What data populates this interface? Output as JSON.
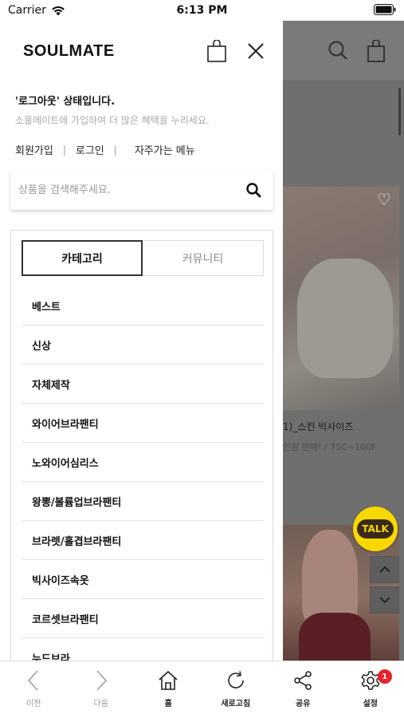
{
  "statusbar": {
    "carrier": "Carrier",
    "time": "6:13 PM"
  },
  "drawer": {
    "logo": "SOULMATE",
    "status_message": "'로그아웃' 상태입니다.",
    "status_sub": "소울메이트에 가입하여 더 많은 혜택을 누리세요.",
    "links": {
      "join": "회원가입",
      "login": "로그인",
      "favorites": "자주가는 메뉴"
    },
    "search": {
      "placeholder": "상품을 검색해주세요.",
      "value": ""
    },
    "tabs": {
      "category": "카테고리",
      "community": "커뮤니티"
    },
    "categories": [
      "베스트",
      "신상",
      "자체제작",
      "와이어브라팬티",
      "노와이어심리스",
      "왕뽕/볼륨업브라팬티",
      "브라렛/홀겹브라팬티",
      "빅사이즈속옷",
      "코르셋브라팬티",
      "누드브라"
    ]
  },
  "background": {
    "product_title": "1)_스킨 빅사이즈",
    "product_sub": "인원 판매! / 75C~100F",
    "talk_label": "TALK"
  },
  "bottombar": {
    "items": [
      {
        "label": "이전",
        "icon": "back-arrow-icon"
      },
      {
        "label": "다음",
        "icon": "forward-arrow-icon"
      },
      {
        "label": "홈",
        "icon": "home-icon"
      },
      {
        "label": "새로고침",
        "icon": "refresh-icon"
      },
      {
        "label": "공유",
        "icon": "share-icon"
      },
      {
        "label": "설정",
        "icon": "gear-icon",
        "badge": "1"
      }
    ]
  },
  "colors": {
    "badge": "#e8222b",
    "talk": "#f7d900",
    "overlay": "#6f6f6f"
  }
}
